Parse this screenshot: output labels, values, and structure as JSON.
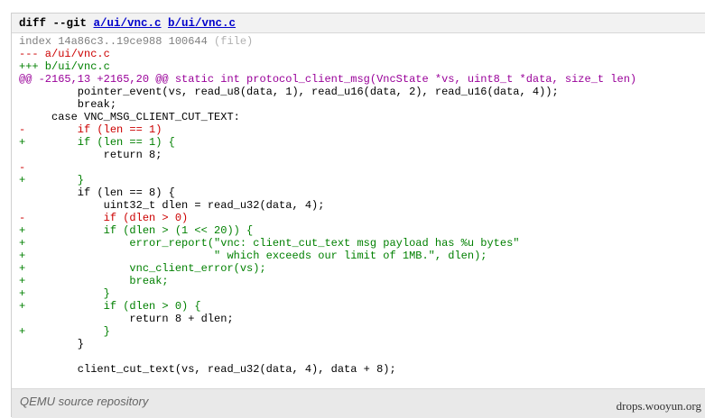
{
  "diff": {
    "prefix": "diff --git ",
    "file_a": "a/ui/vnc.c",
    "file_b": "b/ui/vnc.c",
    "index": "index 14a86c3..19ce988 100644",
    "index_meta": "(file)",
    "minus_file": "--- a/ui/vnc.c",
    "plus_file": "+++ b/ui/vnc.c",
    "hunk": "@@ -2165,13 +2165,20 @@ static int protocol_client_msg(VncState *vs, uint8_t *data, size_t len)",
    "lines": [
      {
        "type": "ctx",
        "text": "         pointer_event(vs, read_u8(data, 1), read_u16(data, 2), read_u16(data, 4));"
      },
      {
        "type": "ctx",
        "text": "         break;"
      },
      {
        "type": "ctx",
        "text": "     case VNC_MSG_CLIENT_CUT_TEXT:"
      },
      {
        "type": "del",
        "text": "-        if (len == 1)"
      },
      {
        "type": "add",
        "text": "+        if (len == 1) {"
      },
      {
        "type": "ctx",
        "text": "             return 8;"
      },
      {
        "type": "del",
        "text": "-"
      },
      {
        "type": "add",
        "text": "+        }"
      },
      {
        "type": "ctx",
        "text": "         if (len == 8) {"
      },
      {
        "type": "ctx",
        "text": "             uint32_t dlen = read_u32(data, 4);"
      },
      {
        "type": "del",
        "text": "-            if (dlen > 0)"
      },
      {
        "type": "add",
        "text": "+            if (dlen > (1 << 20)) {"
      },
      {
        "type": "add",
        "text": "+                error_report(\"vnc: client_cut_text msg payload has %u bytes\""
      },
      {
        "type": "add",
        "text": "+                             \" which exceeds our limit of 1MB.\", dlen);"
      },
      {
        "type": "add",
        "text": "+                vnc_client_error(vs);"
      },
      {
        "type": "add",
        "text": "+                break;"
      },
      {
        "type": "add",
        "text": "+            }"
      },
      {
        "type": "add",
        "text": "+            if (dlen > 0) {"
      },
      {
        "type": "ctx",
        "text": "                 return 8 + dlen;"
      },
      {
        "type": "add",
        "text": "+            }"
      },
      {
        "type": "ctx",
        "text": "         }"
      },
      {
        "type": "ctx",
        "text": ""
      },
      {
        "type": "ctx",
        "text": "         client_cut_text(vs, read_u32(data, 4), data + 8);"
      }
    ]
  },
  "footer": {
    "caption": "QEMU source repository"
  },
  "watermark": "drops.wooyun.org"
}
